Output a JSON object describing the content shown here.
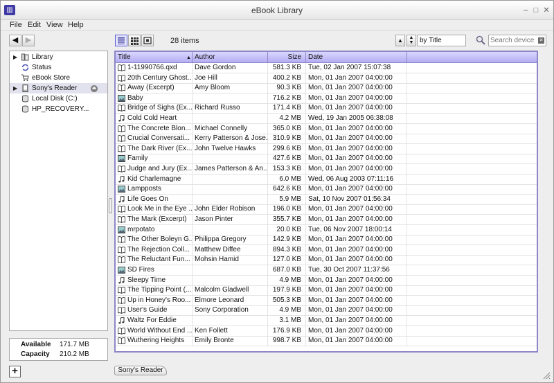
{
  "window": {
    "title": "eBook Library"
  },
  "menu": [
    "File",
    "Edit",
    "View",
    "Help"
  ],
  "toolbar": {
    "item_count": "28 items",
    "sort_by": "by Title",
    "search_placeholder": "Search device"
  },
  "sidebar": {
    "items": [
      {
        "label": "Library",
        "icon": "library-icon",
        "expander": "▶"
      },
      {
        "label": "Status",
        "icon": "sync-icon"
      },
      {
        "label": "eBook Store",
        "icon": "cart-icon"
      },
      {
        "label": "Sony's Reader",
        "icon": "reader-device-icon",
        "expander": "▶",
        "selected": true
      },
      {
        "label": "Local Disk (C:)",
        "icon": "disk-icon"
      },
      {
        "label": "HP_RECOVERY...",
        "icon": "disk-icon"
      }
    ]
  },
  "capacity": {
    "available_label": "Available",
    "available_value": "171.7 MB",
    "capacity_label": "Capacity",
    "capacity_value": "210.2 MB"
  },
  "table": {
    "columns": [
      "Title",
      "Author",
      "Size",
      "Date"
    ],
    "rows": [
      {
        "type": "book",
        "title": "1-11990766.qxd",
        "author": "Dave Gordon",
        "size": "581.3 KB",
        "date": "Tue, 02 Jan 2007 15:07:38"
      },
      {
        "type": "book",
        "title": "20th Century Ghost...",
        "author": "Joe Hill",
        "size": "400.2 KB",
        "date": "Mon, 01 Jan 2007 04:00:00"
      },
      {
        "type": "book",
        "title": "Away (Excerpt)",
        "author": "Amy Bloom",
        "size": "90.3 KB",
        "date": "Mon, 01 Jan 2007 04:00:00"
      },
      {
        "type": "picture",
        "title": "Baby",
        "author": "",
        "size": "716.2 KB",
        "date": "Mon, 01 Jan 2007 04:00:00"
      },
      {
        "type": "book",
        "title": "Bridge of Sighs (Ex...",
        "author": "Richard Russo",
        "size": "171.4 KB",
        "date": "Mon, 01 Jan 2007 04:00:00"
      },
      {
        "type": "music",
        "title": "Cold Cold Heart",
        "author": "",
        "size": "4.2 MB",
        "date": "Wed, 19 Jan 2005 06:38:08"
      },
      {
        "type": "book",
        "title": "The Concrete Blon...",
        "author": "Michael Connelly",
        "size": "365.0 KB",
        "date": "Mon, 01 Jan 2007 04:00:00"
      },
      {
        "type": "book",
        "title": "Crucial Conversati...",
        "author": "Kerry Patterson & Jose...",
        "size": "310.9 KB",
        "date": "Mon, 01 Jan 2007 04:00:00"
      },
      {
        "type": "book",
        "title": "The Dark River (Ex...",
        "author": "John Twelve Hawks",
        "size": "299.6 KB",
        "date": "Mon, 01 Jan 2007 04:00:00"
      },
      {
        "type": "picture",
        "title": "Family",
        "author": "",
        "size": "427.6 KB",
        "date": "Mon, 01 Jan 2007 04:00:00"
      },
      {
        "type": "book",
        "title": "Judge and Jury  (Ex...",
        "author": "James Patterson & An...",
        "size": "153.3 KB",
        "date": "Mon, 01 Jan 2007 04:00:00"
      },
      {
        "type": "music",
        "title": "Kid Charlemagne",
        "author": "",
        "size": "6.0 MB",
        "date": "Wed, 06 Aug 2003 07:11:16"
      },
      {
        "type": "picture",
        "title": "Lampposts",
        "author": "",
        "size": "642.6 KB",
        "date": "Mon, 01 Jan 2007 04:00:00"
      },
      {
        "type": "music",
        "title": "Life Goes On",
        "author": "",
        "size": "5.9 MB",
        "date": "Sat, 10 Nov 2007 01:56:34"
      },
      {
        "type": "book",
        "title": "Look Me in the Eye ...",
        "author": "John Elder Robison",
        "size": "196.0 KB",
        "date": "Mon, 01 Jan 2007 04:00:00"
      },
      {
        "type": "book",
        "title": "The Mark (Excerpt)",
        "author": "Jason Pinter",
        "size": "355.7 KB",
        "date": "Mon, 01 Jan 2007 04:00:00"
      },
      {
        "type": "picture",
        "title": "mrpotato",
        "author": "",
        "size": "20.0 KB",
        "date": "Tue, 06 Nov 2007 18:00:14"
      },
      {
        "type": "book",
        "title": "The Other Boleyn G...",
        "author": "Philippa Gregory",
        "size": "142.9 KB",
        "date": "Mon, 01 Jan 2007 04:00:00"
      },
      {
        "type": "book",
        "title": "The Rejection Coll...",
        "author": "Matthew Diffee",
        "size": "894.3 KB",
        "date": "Mon, 01 Jan 2007 04:00:00"
      },
      {
        "type": "book",
        "title": "The Reluctant Fun...",
        "author": "Mohsin Hamid",
        "size": "127.0 KB",
        "date": "Mon, 01 Jan 2007 04:00:00"
      },
      {
        "type": "picture",
        "title": "SD Fires",
        "author": "",
        "size": "687.0 KB",
        "date": "Tue, 30 Oct 2007 11:37:56"
      },
      {
        "type": "music",
        "title": "Sleepy Time",
        "author": "",
        "size": "4.9 MB",
        "date": "Mon, 01 Jan 2007 04:00:00"
      },
      {
        "type": "book",
        "title": "The Tipping Point (...",
        "author": "Malcolm Gladwell",
        "size": "197.9 KB",
        "date": "Mon, 01 Jan 2007 04:00:00"
      },
      {
        "type": "book",
        "title": "Up in Honey's Roo...",
        "author": "Elmore Leonard",
        "size": "505.3 KB",
        "date": "Mon, 01 Jan 2007 04:00:00"
      },
      {
        "type": "book",
        "title": "User's Guide",
        "author": "Sony Corporation",
        "size": "4.9 MB",
        "date": "Mon, 01 Jan 2007 04:00:00"
      },
      {
        "type": "music",
        "title": "Waltz For Eddie",
        "author": "",
        "size": "3.1 MB",
        "date": "Mon, 01 Jan 2007 04:00:00"
      },
      {
        "type": "book",
        "title": "World Without End ...",
        "author": "Ken Follett",
        "size": "176.9 KB",
        "date": "Mon, 01 Jan 2007 04:00:00"
      },
      {
        "type": "book",
        "title": "Wuthering Heights",
        "author": "Emily Bronte",
        "size": "998.7 KB",
        "date": "Mon, 01 Jan 2007 04:00:00"
      }
    ]
  },
  "bottom_tab": "Sony's Reader",
  "colors": {
    "accent": "#8d86c8",
    "header": "#b4aef2",
    "background": "#eeeeee",
    "frame": "#6e0000"
  }
}
